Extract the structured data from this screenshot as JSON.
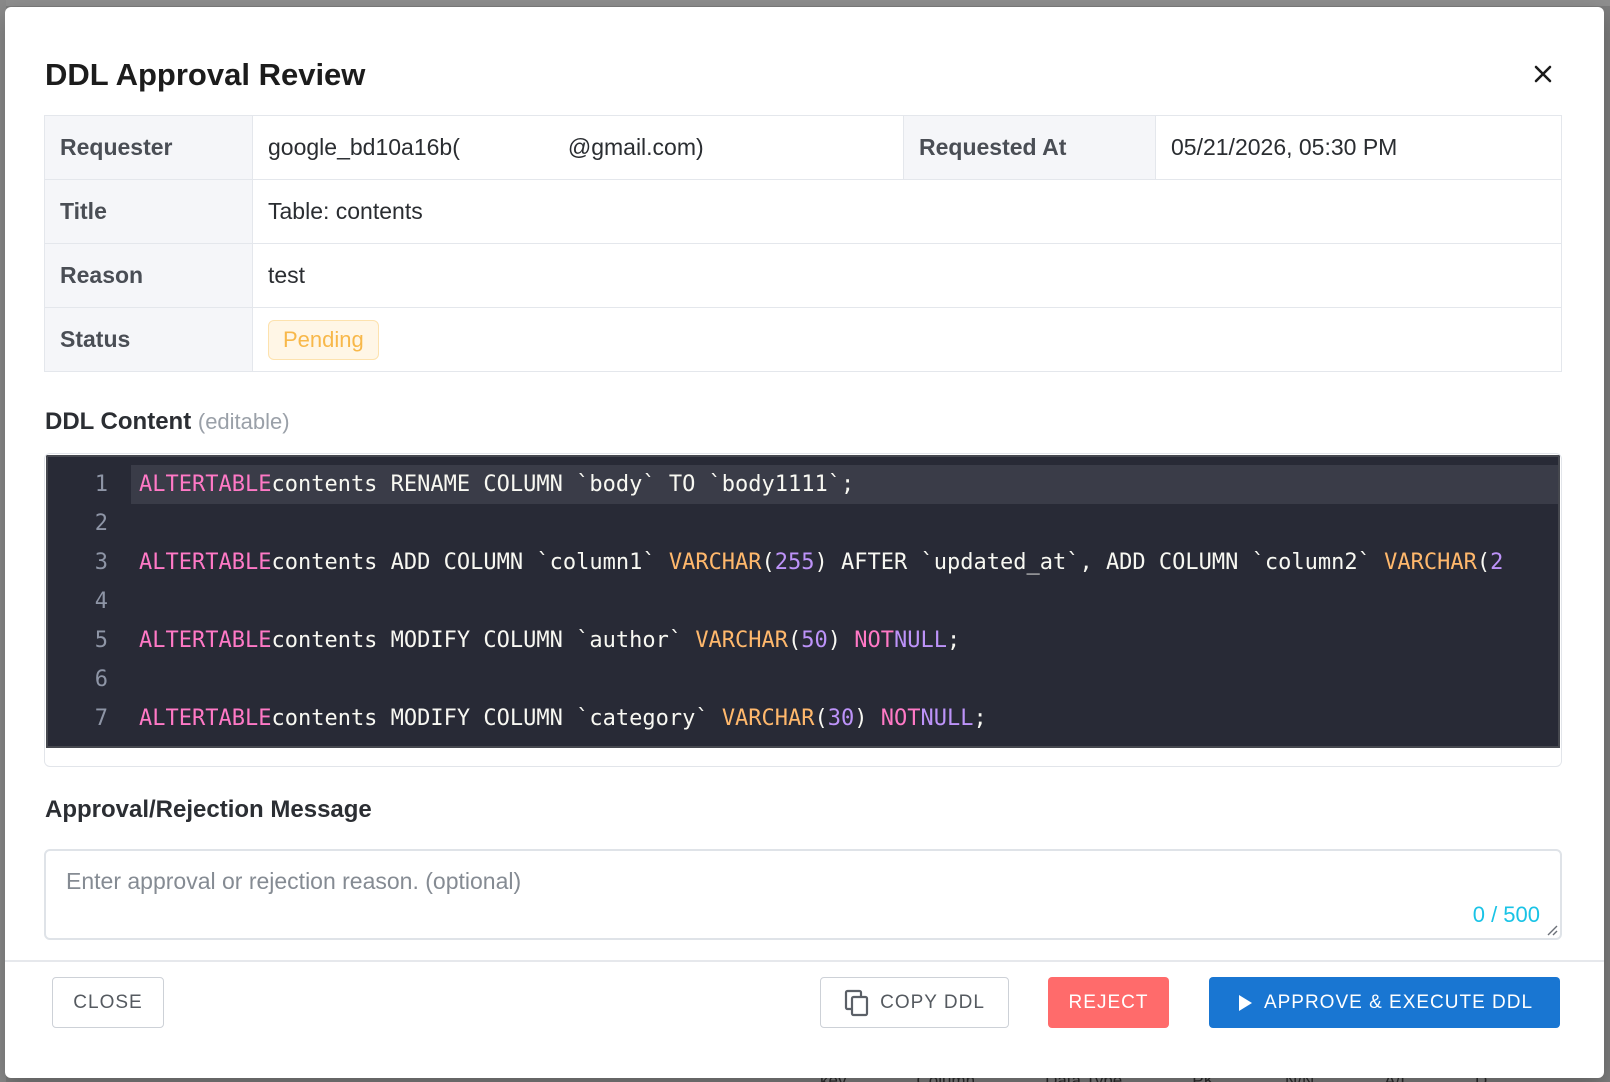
{
  "background": {
    "bottom_columns": [
      "key",
      "Column",
      "Data Type",
      "PK",
      "N/N",
      "A/I",
      "D"
    ]
  },
  "modal": {
    "title": "DDL Approval Review",
    "close_icon": "close-icon"
  },
  "info": {
    "requester_label": "Requester",
    "requester_value_prefix": "google_bd10a16b(",
    "requester_value_suffix": "@gmail.com)",
    "requested_at_label": "Requested At",
    "requested_at_value": "05/21/2026, 05:30 PM",
    "title_label": "Title",
    "title_value": "Table: contents",
    "reason_label": "Reason",
    "reason_value": "test",
    "status_label": "Status",
    "status_value": "Pending"
  },
  "ddl": {
    "label": "DDL Content",
    "label_hint": "(editable)",
    "line_numbers": [
      "1",
      "2",
      "3",
      "4",
      "5",
      "6",
      "7"
    ],
    "lines": [
      "ALTER TABLE contents RENAME COLUMN `body` TO `body1111`;",
      "",
      "ALTER TABLE contents ADD COLUMN `column1` VARCHAR(255) AFTER `updated_at`, ADD COLUMN `column2` VARCHAR(2",
      "",
      "ALTER TABLE contents MODIFY COLUMN `author` VARCHAR(50) NOT NULL;",
      "",
      "ALTER TABLE contents MODIFY COLUMN `category` VARCHAR(30) NOT NULL;"
    ]
  },
  "message": {
    "label": "Approval/Rejection Message",
    "placeholder": "Enter approval or rejection reason. (optional)",
    "counter": "0 / 500"
  },
  "buttons": {
    "close": "CLOSE",
    "copy": "COPY DDL",
    "reject": "REJECT",
    "approve": "APPROVE & EXECUTE DDL"
  },
  "colors": {
    "primary": "#1976d2",
    "danger": "#ff6b6b",
    "pending": "#f8b84a",
    "editor_bg": "#282a36"
  }
}
